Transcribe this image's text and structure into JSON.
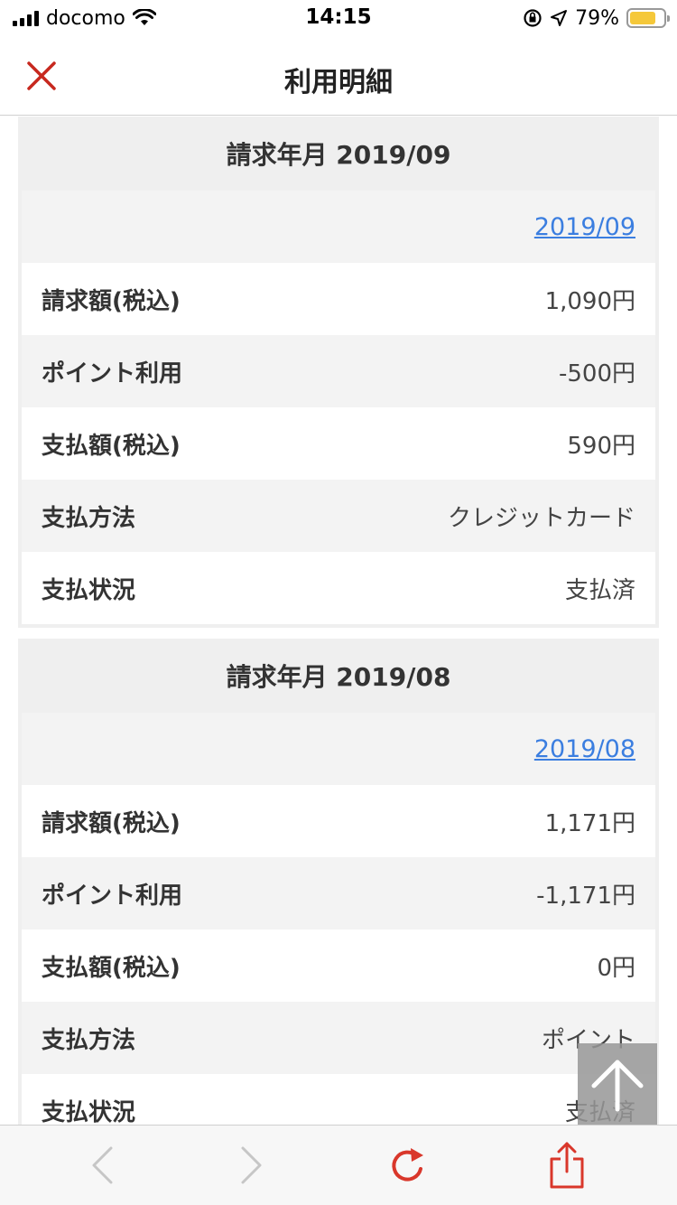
{
  "status_bar": {
    "carrier": "docomo",
    "time": "14:15",
    "battery_pct": "79%",
    "battery_level": 0.79,
    "battery_color": "#f5c83a"
  },
  "header": {
    "title": "利用明細",
    "close_icon": "close-icon",
    "close_color": "#c7281e"
  },
  "statements": [
    {
      "heading": "請求年月 2019/09",
      "month_link": "2019/09",
      "rows": [
        {
          "label": "請求額(税込)",
          "value": "1,090円"
        },
        {
          "label": "ポイント利用",
          "value": "-500円"
        },
        {
          "label": "支払額(税込)",
          "value": "590円"
        },
        {
          "label": "支払方法",
          "value": "クレジットカード"
        },
        {
          "label": "支払状況",
          "value": "支払済"
        }
      ]
    },
    {
      "heading": "請求年月 2019/08",
      "month_link": "2019/08",
      "rows": [
        {
          "label": "請求額(税込)",
          "value": "1,171円"
        },
        {
          "label": "ポイント利用",
          "value": "-1,171円"
        },
        {
          "label": "支払額(税込)",
          "value": "0円"
        },
        {
          "label": "支払方法",
          "value": "ポイント"
        },
        {
          "label": "支払状況",
          "value": "支払済"
        }
      ]
    }
  ],
  "toolbar": {
    "icons": [
      "back-icon",
      "forward-icon",
      "reload-icon",
      "share-icon"
    ],
    "accent": "#d9372b"
  }
}
